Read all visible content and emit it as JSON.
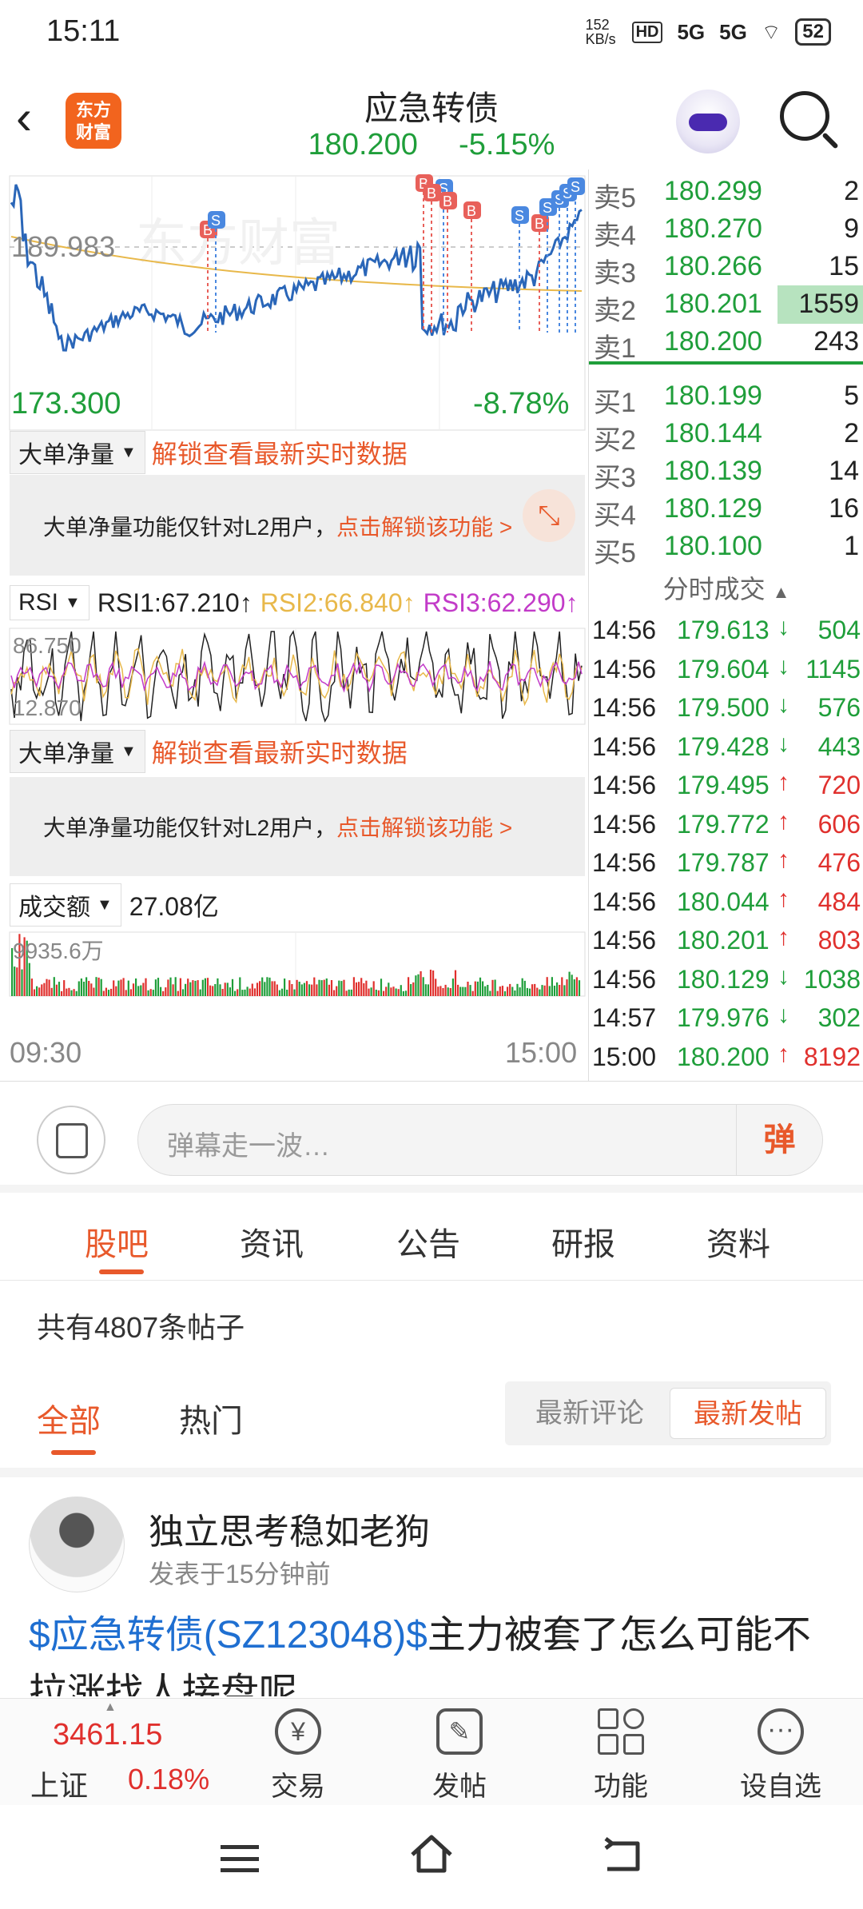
{
  "status_bar": {
    "time": "15:11",
    "net_speed": "152 KB/s",
    "signal1": "5G",
    "signal2": "5G",
    "battery": "52"
  },
  "header": {
    "title": "应急转债",
    "price": "180.200",
    "change_pct": "-5.15%",
    "logo_line1": "东方",
    "logo_line2": "财富"
  },
  "chart": {
    "max_label": "189.983",
    "min_label": "173.300",
    "pct_label": "-8.78%",
    "watermark": "东方财富",
    "unlock_select1": "大单净量",
    "unlock_link1": "解锁查看最新实时数据",
    "unlock_banner1_text": "大单净量功能仅针对L2用户，",
    "unlock_banner1_link": "点击解锁该功能 >",
    "rsi_select": "RSI",
    "rsi1": "RSI1:67.210↑",
    "rsi2": "RSI2:66.840↑",
    "rsi3": "RSI3:62.290↑",
    "rsi_top": "86.750",
    "rsi_bottom": "12.870",
    "unlock_select2": "大单净量",
    "unlock_link2": "解锁查看最新实时数据",
    "unlock_banner2_text": "大单净量功能仅针对L2用户，",
    "unlock_banner2_link": "点击解锁该功能 >",
    "volume_select": "成交额",
    "volume_total": "27.08亿",
    "volume_max": "9935.6万",
    "time_start": "09:30",
    "time_end": "15:00",
    "colors": {
      "price_line": "#2a66b8",
      "avg_line": "#e8b84a",
      "rsi1": "#222222",
      "rsi2": "#e8b84a",
      "rsi3": "#c23bc8",
      "up": "#e0302d",
      "down": "#1f9e3a"
    }
  },
  "orderbook": {
    "asks": [
      {
        "label": "卖5",
        "price": "180.299",
        "vol": "2"
      },
      {
        "label": "卖4",
        "price": "180.270",
        "vol": "9"
      },
      {
        "label": "卖3",
        "price": "180.266",
        "vol": "15"
      },
      {
        "label": "卖2",
        "price": "180.201",
        "vol": "1559"
      },
      {
        "label": "卖1",
        "price": "180.200",
        "vol": "243"
      }
    ],
    "bids": [
      {
        "label": "买1",
        "price": "180.199",
        "vol": "5"
      },
      {
        "label": "买2",
        "price": "180.144",
        "vol": "2"
      },
      {
        "label": "买3",
        "price": "180.139",
        "vol": "14"
      },
      {
        "label": "买4",
        "price": "180.129",
        "vol": "16"
      },
      {
        "label": "买5",
        "price": "180.100",
        "vol": "1"
      }
    ],
    "ticks_header": "分时成交",
    "ticks": [
      {
        "t": "14:56",
        "p": "179.613",
        "dir": "↓",
        "v": "504",
        "up": false
      },
      {
        "t": "14:56",
        "p": "179.604",
        "dir": "↓",
        "v": "1145",
        "up": false
      },
      {
        "t": "14:56",
        "p": "179.500",
        "dir": "↓",
        "v": "576",
        "up": false
      },
      {
        "t": "14:56",
        "p": "179.428",
        "dir": "↓",
        "v": "443",
        "up": false
      },
      {
        "t": "14:56",
        "p": "179.495",
        "dir": "↑",
        "v": "720",
        "up": true
      },
      {
        "t": "14:56",
        "p": "179.772",
        "dir": "↑",
        "v": "606",
        "up": true
      },
      {
        "t": "14:56",
        "p": "179.787",
        "dir": "↑",
        "v": "476",
        "up": true
      },
      {
        "t": "14:56",
        "p": "180.044",
        "dir": "↑",
        "v": "484",
        "up": true
      },
      {
        "t": "14:56",
        "p": "180.201",
        "dir": "↑",
        "v": "803",
        "up": true
      },
      {
        "t": "14:56",
        "p": "180.129",
        "dir": "↓",
        "v": "1038",
        "up": false
      },
      {
        "t": "14:57",
        "p": "179.976",
        "dir": "↓",
        "v": "302",
        "up": false
      },
      {
        "t": "15:00",
        "p": "180.200",
        "dir": "↑",
        "v": "8192",
        "up": true
      }
    ]
  },
  "danmaku": {
    "placeholder": "弹幕走一波…",
    "button": "弹"
  },
  "tabs": [
    "股吧",
    "资讯",
    "公告",
    "研报",
    "资料"
  ],
  "forum": {
    "post_count": "共有4807条帖子",
    "sub_tabs": [
      "全部",
      "热门"
    ],
    "sort_options": [
      "最新评论",
      "最新发帖"
    ]
  },
  "post": {
    "author": "独立思考稳如老狗",
    "time": "发表于15分钟前",
    "link": "$应急转债(SZ123048)$",
    "text": "主力被套了怎么可能不拉涨找人接盘呢"
  },
  "bottom": {
    "index_value": "3461.15",
    "index_name": "上证",
    "index_change": "0.18%",
    "nav": [
      "交易",
      "发帖",
      "功能",
      "设自选"
    ]
  }
}
